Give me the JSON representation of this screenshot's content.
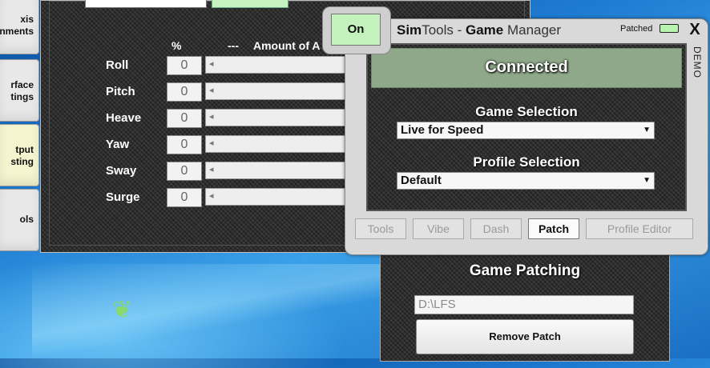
{
  "sidebar": {
    "items": [
      {
        "label": "xis\nnments"
      },
      {
        "label": "rface\ntings"
      },
      {
        "label": "tput\nsting",
        "active": true
      },
      {
        "label": "ols"
      }
    ]
  },
  "axis_window": {
    "header_percent": "%",
    "header_dashes": "---",
    "header_amount": "Amount of A",
    "rows": [
      {
        "label": "Roll",
        "value": "0"
      },
      {
        "label": "Pitch",
        "value": "0"
      },
      {
        "label": "Heave",
        "value": "0"
      },
      {
        "label": "Yaw",
        "value": "0"
      },
      {
        "label": "Sway",
        "value": "0"
      },
      {
        "label": "Surge",
        "value": "0"
      }
    ]
  },
  "simtools": {
    "on_button": "On",
    "title_sim": "Sim",
    "title_tools": "Tools - ",
    "title_game": "Game",
    "title_manager": " Manager",
    "patched_label": "Patched",
    "close": "X",
    "demo": "DEMO",
    "status": "Connected",
    "game_selection_label": "Game Selection",
    "game_selection_value": "Live for Speed",
    "profile_selection_label": "Profile Selection",
    "profile_selection_value": "Default",
    "tabs": [
      {
        "label": "Tools"
      },
      {
        "label": "Vibe"
      },
      {
        "label": "Dash"
      },
      {
        "label": "Patch",
        "active": true
      },
      {
        "label": "Profile Editor"
      }
    ],
    "colors": {
      "connected": "#8fa88a",
      "on": "#c3f2bd",
      "patched_indicator": "#b9f3b0"
    }
  },
  "patch_panel": {
    "title": "Game Patching",
    "path_value": "D:\\LFS",
    "remove_button": "Remove Patch"
  }
}
